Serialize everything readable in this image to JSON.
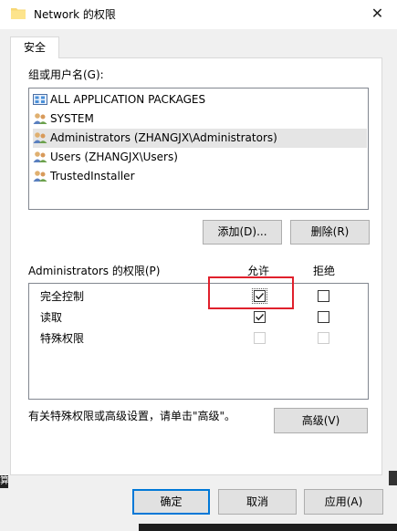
{
  "window": {
    "title": "Network 的权限",
    "close_glyph": "✕"
  },
  "tabs": [
    {
      "label": "安全"
    }
  ],
  "groups": {
    "label": "组或用户名(G):",
    "items": [
      {
        "label": "ALL APPLICATION PACKAGES",
        "icon": "app-packages-icon"
      },
      {
        "label": "SYSTEM",
        "icon": "users-icon"
      },
      {
        "label": "Administrators (ZHANGJX\\Administrators)",
        "icon": "users-icon",
        "selected": true
      },
      {
        "label": "Users (ZHANGJX\\Users)",
        "icon": "users-icon"
      },
      {
        "label": "TrustedInstaller",
        "icon": "users-icon"
      }
    ],
    "add_button": "添加(D)...",
    "remove_button": "删除(R)"
  },
  "permissions": {
    "label": "Administrators 的权限(P)",
    "allow_header": "允许",
    "deny_header": "拒绝",
    "rows": [
      {
        "name": "完全控制",
        "allow": true,
        "deny": false,
        "enabled": true
      },
      {
        "name": "读取",
        "allow": true,
        "deny": false,
        "enabled": true
      },
      {
        "name": "特殊权限",
        "allow": false,
        "deny": false,
        "enabled": false
      }
    ]
  },
  "advanced": {
    "note": "有关特殊权限或高级设置，请单击\"高级\"。",
    "button": "高级(V)"
  },
  "footer": {
    "ok": "确定",
    "cancel": "取消",
    "apply": "应用(A)"
  },
  "background_fragment": "算",
  "colors": {
    "accent": "#0078d7",
    "highlight": "#e0202c",
    "face": "#f0f0f0"
  }
}
